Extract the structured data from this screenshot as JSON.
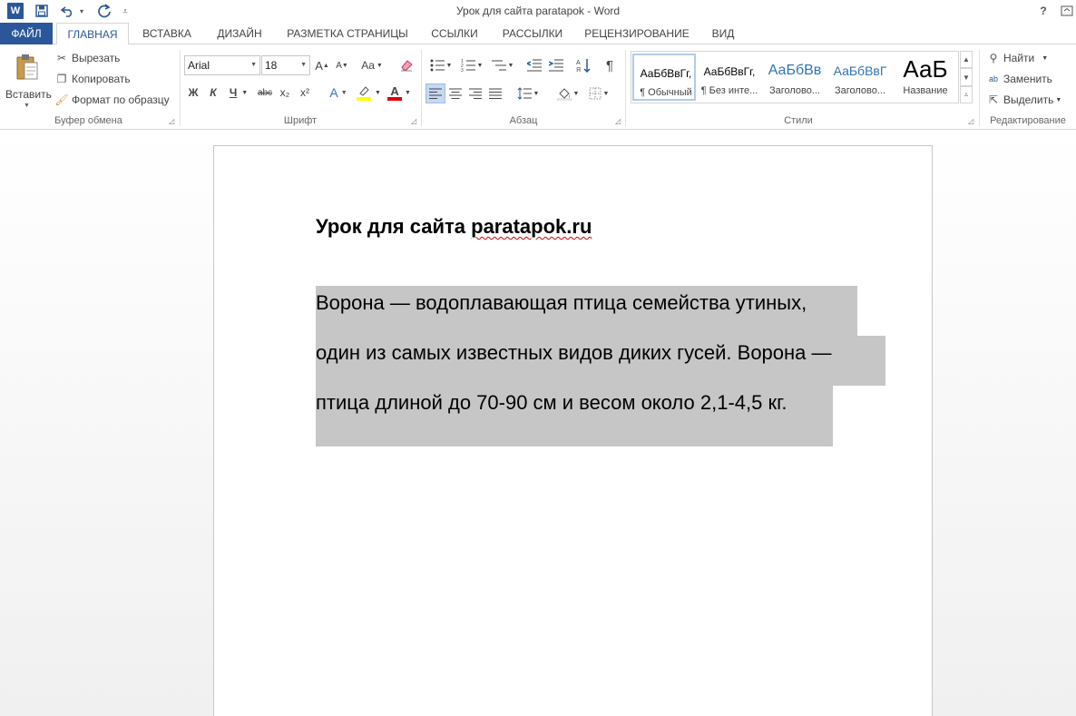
{
  "titlebar": {
    "app_icon_letter": "W",
    "doc_title": "Урок для сайта paratapok - Word",
    "help": "?"
  },
  "tabs": [
    "ФАЙЛ",
    "ГЛАВНАЯ",
    "ВСТАВКА",
    "ДИЗАЙН",
    "РАЗМЕТКА СТРАНИЦЫ",
    "ССЫЛКИ",
    "РАССЫЛКИ",
    "РЕЦЕНЗИРОВАНИЕ",
    "ВИД"
  ],
  "clipboard": {
    "paste": "Вставить",
    "cut": "Вырезать",
    "copy": "Копировать",
    "format_painter": "Формат по образцу",
    "label": "Буфер обмена"
  },
  "font": {
    "name": "Arial",
    "size": "18",
    "grow": "A",
    "shrink": "A",
    "case": "Aa",
    "bold": "Ж",
    "italic": "К",
    "underline": "Ч",
    "strike": "abc",
    "subscript": "x₂",
    "superscript": "x²",
    "effects": "A",
    "font_color": "A",
    "label": "Шрифт"
  },
  "paragraph": {
    "label": "Абзац",
    "pilcrow": "¶"
  },
  "styles": {
    "label": "Стили",
    "items": [
      {
        "preview": "АаБбВвГг,",
        "name": "¶ Обычный"
      },
      {
        "preview": "АаБбВвГг,",
        "name": "¶ Без инте..."
      },
      {
        "preview": "АаБбВв",
        "name": "Заголово..."
      },
      {
        "preview": "АаБбВвГ",
        "name": "Заголово..."
      },
      {
        "preview": "АаБ",
        "name": "Название"
      }
    ]
  },
  "editing": {
    "find": "Найти",
    "replace": "Заменить",
    "select": "Выделить",
    "label": "Редактирование"
  },
  "document": {
    "heading_prefix": "Урок для сайта ",
    "heading_link": "paratapok.ru",
    "lines": [
      "Ворона — водоплавающая птица семейства утиных,",
      "один из самых известных видов диких гусей. Ворона —",
      "птица длиной до 70-90 см и весом около 2,1-4,5 кг."
    ]
  },
  "colors": {
    "accent": "#2b579a",
    "selection": "#c6c6c6",
    "highlight": "#ffff00",
    "font_color_bar": "#e00000"
  }
}
